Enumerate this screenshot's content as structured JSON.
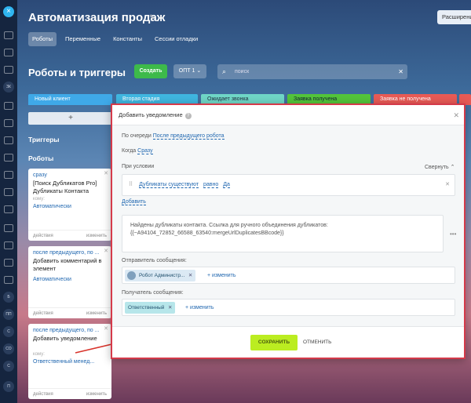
{
  "app": {
    "title": "Автоматизация продаж",
    "extended_label": "Расширения"
  },
  "tabs": [
    {
      "label": "Роботы"
    },
    {
      "label": "Переменные"
    },
    {
      "label": "Константы"
    },
    {
      "label": "Сессии отладки"
    }
  ],
  "toolbar": {
    "section_title": "Роботы и триггеры",
    "create_label": "Создать",
    "dropdown_value": "ОПТ 1",
    "search_placeholder": "поиск"
  },
  "stages": [
    {
      "label": "Новый клиент",
      "color": "#3fa9e8"
    },
    {
      "label": "Вторая стадия",
      "color": "#3fb6e0"
    },
    {
      "label": "Ожидает звонка",
      "color": "#6fd6c6"
    },
    {
      "label": "Заявка получена",
      "color": "#53c43a"
    },
    {
      "label": "Заявка не получена",
      "color": "#e85a55"
    }
  ],
  "side": {
    "add_label": "+",
    "triggers_label": "Триггеры",
    "robots_label": "Роботы"
  },
  "rail": {
    "close": "×",
    "circles": [
      "ЗК",
      "Б",
      "ПП",
      "С",
      "СО",
      "С",
      "П"
    ]
  },
  "cards": [
    {
      "when": "сразу",
      "name": "[Поиск Дубликатов Pro] Дубликаты Контакта",
      "who": "кому:",
      "value": "Автоматически",
      "settings": "действия",
      "edit": "изменить"
    },
    {
      "when": "после предыдущего, по ...",
      "name": "Добавить комментарий в элемент",
      "who": "кому:",
      "value": "Автоматически",
      "settings": "действия",
      "edit": "изменить"
    },
    {
      "when": "после предыдущего, по ...",
      "name": "Добавить уведомление",
      "who": "кому:",
      "value": "Ответственный менед...",
      "settings": "действия",
      "edit": "изменить"
    }
  ],
  "modal": {
    "title": "Добавить уведомление",
    "queue_label": "По очереди",
    "queue_value": "После предыдущего робота",
    "when_label": "Когда",
    "when_value": "Сразу",
    "condition_label": "При условии",
    "collapse_label": "Свернуть",
    "condition": {
      "field": "Дубликаты существуют",
      "operator": "равно",
      "value": "Да"
    },
    "add_label": "Добавить",
    "message": "Найдены дубликаты контакта. Ссылка для ручного объединения дубликатов: {{~A94104_72852_66588_63540:mergeUrlDuplicatesBBcode}}",
    "sender_label": "Отправитель сообщения:",
    "sender_value": "Робот Администр...",
    "sender_change": "+ изменить",
    "receiver_label": "Получатель сообщения:",
    "receiver_value": "Ответственный",
    "receiver_change": "+ изменить",
    "save_label": "СОХРАНИТЬ",
    "cancel_label": "ОТМЕНИТЬ"
  }
}
